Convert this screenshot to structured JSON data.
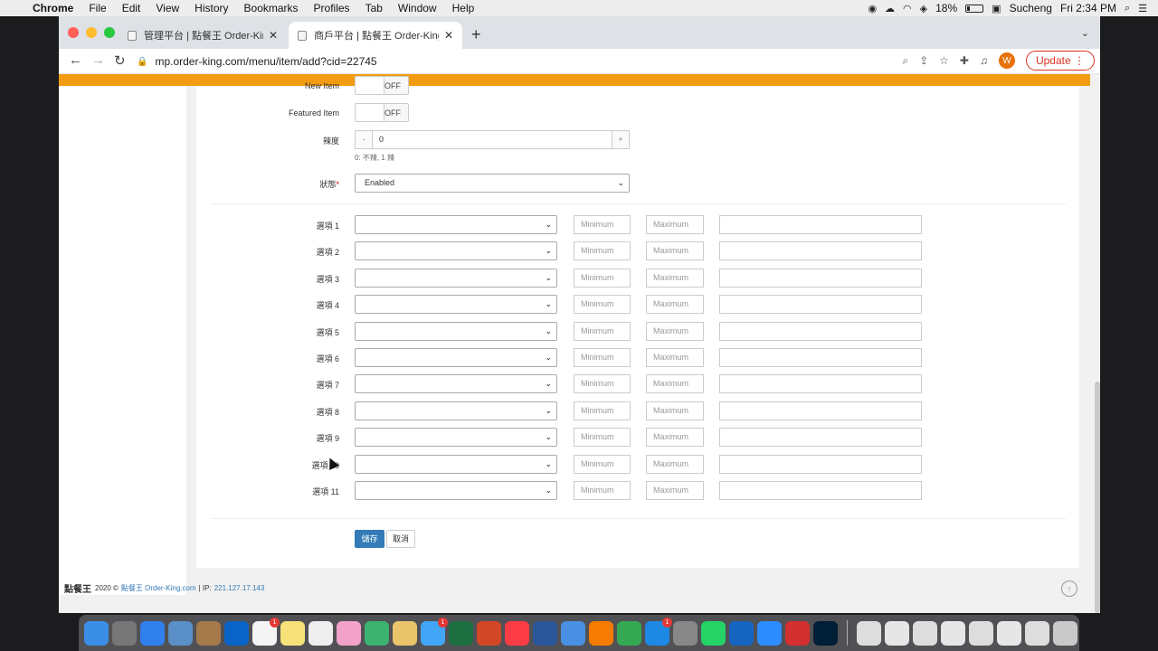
{
  "menubar": {
    "app": "Chrome",
    "items": [
      "File",
      "Edit",
      "View",
      "History",
      "Bookmarks",
      "Profiles",
      "Tab",
      "Window",
      "Help"
    ],
    "battery": "18%",
    "user": "Sucheng",
    "clock": "Fri 2:34 PM"
  },
  "browser": {
    "tabs": [
      {
        "title": "管理平台 | 點餐王 Order-King.c"
      },
      {
        "title": "商戶平台 | 點餐王 Order-King.c"
      }
    ],
    "url": "mp.order-king.com/menu/item/add?cid=22745",
    "avatar_letter": "W",
    "update_label": "Update"
  },
  "form": {
    "new_item_toggle": {
      "label": "New Item",
      "state": "OFF"
    },
    "featured_item": {
      "label": "Featured Item",
      "state": "OFF"
    },
    "spiciness": {
      "label": "辣度",
      "minus": "-",
      "value": "0",
      "plus": "+",
      "hint": "0: 不辣, 1 辣"
    },
    "status": {
      "label": "狀態",
      "required": "*",
      "value": "Enabled"
    },
    "option_placeholders": {
      "min": "Minimum",
      "max": "Maximum"
    },
    "options": [
      {
        "label": "選項 1"
      },
      {
        "label": "選項 2"
      },
      {
        "label": "選項 3"
      },
      {
        "label": "選項 4"
      },
      {
        "label": "選項 5"
      },
      {
        "label": "選項 6"
      },
      {
        "label": "選項 7"
      },
      {
        "label": "選項 8"
      },
      {
        "label": "選項 9"
      },
      {
        "label": "選項 10"
      },
      {
        "label": "選項 11"
      }
    ],
    "save_label": "儲存",
    "cancel_label": "取消"
  },
  "footer": {
    "logo": "點餐王",
    "copyright": "2020 ©",
    "brand_link": "點餐王 Order-King.com",
    "ip_label": "| IP:",
    "ip": "221.127.17.143"
  },
  "colors": {
    "accent_orange": "#f39c12",
    "primary_blue": "#337ab7",
    "update_red": "#d93025"
  }
}
